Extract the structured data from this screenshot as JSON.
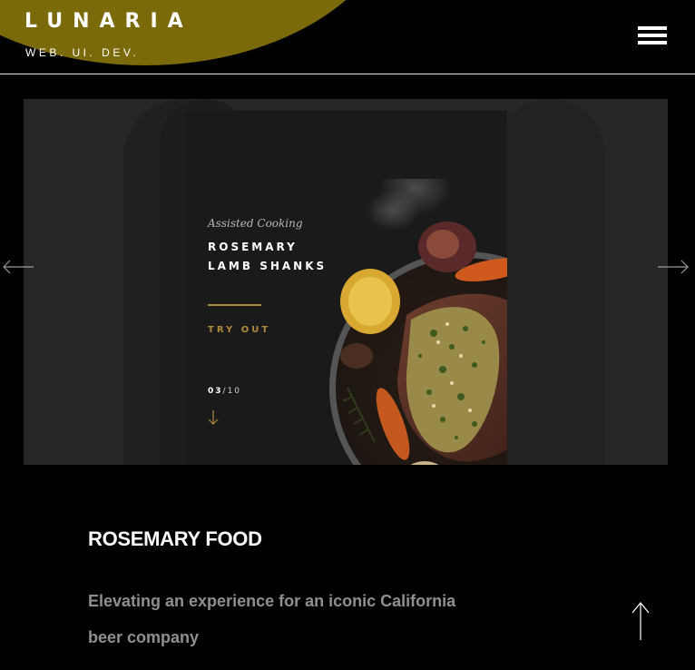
{
  "header": {
    "logo": "LUNARIA",
    "tagline": "WEB. UI. DEV.",
    "menu_icon": "hamburger-menu-icon",
    "accent_color": "#7a6a0a"
  },
  "slider": {
    "prev_icon": "arrow-left-icon",
    "next_icon": "arrow-right-icon",
    "card": {
      "kicker": "Assisted Cooking",
      "title": "ROSEMARY LAMB SHANKS",
      "cta": "TRY OUT",
      "counter_current": "03",
      "counter_total": "/10",
      "down_icon": "arrow-down-icon",
      "accent_color": "#b08a3c"
    }
  },
  "project": {
    "title": "ROSEMARY FOOD",
    "description": "Elevating an experience for an iconic California beer company"
  },
  "footer": {
    "back_to_top_icon": "arrow-up-icon"
  }
}
